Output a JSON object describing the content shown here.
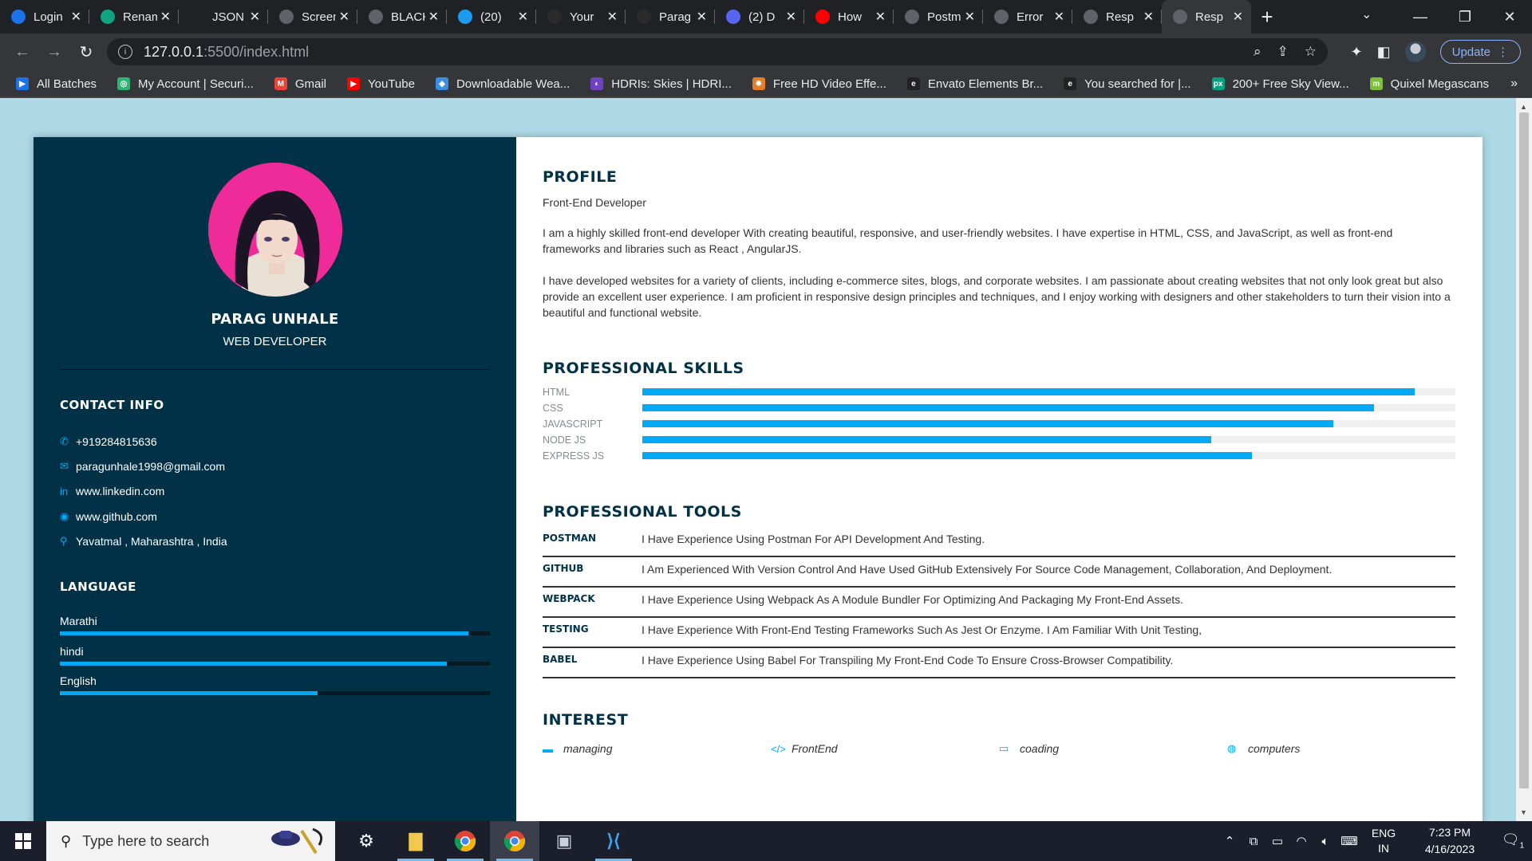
{
  "browser": {
    "tabs": [
      {
        "title": "Login",
        "icon": "pw-icon",
        "color": "#1a73e8"
      },
      {
        "title": "Rename",
        "icon": "chatgpt-icon",
        "color": "#10a37f"
      },
      {
        "title": "JSON",
        "icon": "blank-icon",
        "color": "#202124"
      },
      {
        "title": "Screen",
        "icon": "camera-icon",
        "color": "#5f6368"
      },
      {
        "title": "BLACK",
        "icon": "dots-icon",
        "color": "#5f6368"
      },
      {
        "title": "(20)",
        "icon": "twitter-icon",
        "color": "#1d9bf0"
      },
      {
        "title": "Your",
        "icon": "github-icon",
        "color": "#2b2b2b"
      },
      {
        "title": "Parag",
        "icon": "github-icon",
        "color": "#2b2b2b"
      },
      {
        "title": "(2) D",
        "icon": "discord-icon",
        "color": "#5865f2"
      },
      {
        "title": "How",
        "icon": "youtube-icon",
        "color": "#ff0000"
      },
      {
        "title": "Postm",
        "icon": "globe-icon",
        "color": "#5f6368"
      },
      {
        "title": "Error",
        "icon": "globe-icon",
        "color": "#5f6368"
      },
      {
        "title": "Resp",
        "icon": "globe-icon",
        "color": "#5f6368"
      },
      {
        "title": "Resp",
        "icon": "globe-icon",
        "color": "#5f6368",
        "active": true
      }
    ],
    "url_host": "127.0.0.1",
    "url_path": ":5500/index.html",
    "update_label": "Update",
    "bookmarks": [
      {
        "label": "All Batches",
        "color": "#1a73e8",
        "glyph": "▶"
      },
      {
        "label": "My Account | Securi...",
        "color": "#2bb673",
        "glyph": "◎"
      },
      {
        "label": "Gmail",
        "color": "#ea4335",
        "glyph": "M"
      },
      {
        "label": "YouTube",
        "color": "#ff0000",
        "glyph": "▶"
      },
      {
        "label": "Downloadable Wea...",
        "color": "#3a8ee6",
        "glyph": "◆"
      },
      {
        "label": "HDRIs: Skies | HDRI...",
        "color": "#6f42c1",
        "glyph": "◐"
      },
      {
        "label": "Free HD Video Effe...",
        "color": "#e67e22",
        "glyph": "✸"
      },
      {
        "label": "Envato Elements Br...",
        "color": "#222222",
        "glyph": "e"
      },
      {
        "label": "You searched for |...",
        "color": "#222222",
        "glyph": "e"
      },
      {
        "label": "200+ Free Sky View...",
        "color": "#05a081",
        "glyph": "px"
      },
      {
        "label": "Quixel Megascans",
        "color": "#7fbf3f",
        "glyph": "m"
      }
    ]
  },
  "resume": {
    "name": "PARAG UNHALE",
    "role": "WEB DEVELOPER",
    "contact_title": "CONTACT INFO",
    "contacts": [
      {
        "icon": "phone-icon",
        "glyph": "✆",
        "text": "+919284815636"
      },
      {
        "icon": "envelope-icon",
        "glyph": "✉",
        "text": "paragunhale1998@gmail.com"
      },
      {
        "icon": "linkedin-icon",
        "glyph": "in",
        "text": "www.linkedin.com"
      },
      {
        "icon": "github-icon",
        "glyph": "◉",
        "text": "www.github.com"
      },
      {
        "icon": "map-pin-icon",
        "glyph": "⚲",
        "text": "Yavatmal , Maharashtra , India"
      }
    ],
    "language_title": "LANGUAGE",
    "languages": [
      {
        "name": "Marathi",
        "level": 0.95
      },
      {
        "name": "hindi",
        "level": 0.9
      },
      {
        "name": "English",
        "level": 0.6
      }
    ],
    "profile_title": "PROFILE",
    "profile_sub": "Front-End Developer",
    "profile_p1": "I am a highly skilled front-end developer With creating beautiful, responsive, and user-friendly websites. I have expertise in HTML, CSS, and JavaScript, as well as front-end frameworks and libraries such as React , AngularJS.",
    "profile_p2": "I have developed websites for a variety of clients, including e-commerce sites, blogs, and corporate websites. I am passionate about creating websites that not only look great but also provide an excellent user experience. I am proficient in responsive design principles and techniques, and I enjoy working with designers and other stakeholders to turn their vision into a beautiful and functional website.",
    "skills_title": "PROFESSIONAL SKILLS",
    "skills": [
      {
        "name": "HTML",
        "level": 0.95
      },
      {
        "name": "CSS",
        "level": 0.9
      },
      {
        "name": "JAVASCRIPT",
        "level": 0.85
      },
      {
        "name": "NODE JS",
        "level": 0.7
      },
      {
        "name": "EXPRESS JS",
        "level": 0.75
      }
    ],
    "tools_title": "PROFESSIONAL TOOLS",
    "tools": [
      {
        "name": "POSTMAN",
        "desc": "I Have Experience Using Postman For API Development And Testing."
      },
      {
        "name": "GITHUB",
        "desc": "I Am Experienced With Version Control And Have Used GitHub Extensively For Source Code Management, Collaboration, And Deployment."
      },
      {
        "name": "WEBPACK",
        "desc": "I Have Experience Using Webpack As A Module Bundler For Optimizing And Packaging My Front-End Assets."
      },
      {
        "name": "TESTING",
        "desc": "I Have Experience With Front-End Testing Frameworks Such As Jest Or Enzyme. I Am Familiar With Unit Testing,"
      },
      {
        "name": "BABEL",
        "desc": "I Have Experience Using Babel For Transpiling My Front-End Code To Ensure Cross-Browser Compatibility."
      }
    ],
    "interest_title": "INTEREST",
    "interests": [
      {
        "icon": "briefcase-icon",
        "glyph": "▬",
        "label": "managing"
      },
      {
        "icon": "code-icon",
        "glyph": "</>",
        "label": "FrontEnd"
      },
      {
        "icon": "laptop-icon",
        "glyph": "▭",
        "label": "coading"
      },
      {
        "icon": "gamepad-icon",
        "glyph": "◍",
        "label": "computers"
      }
    ],
    "accent": "#03a9f4",
    "sidebar_bg": "#003147",
    "page_bg": "#add8e6"
  },
  "taskbar": {
    "search_placeholder": "Type here to search",
    "lang_line1": "ENG",
    "lang_line2": "IN",
    "time": "7:23 PM",
    "date": "4/16/2023",
    "notif_count": "1"
  }
}
